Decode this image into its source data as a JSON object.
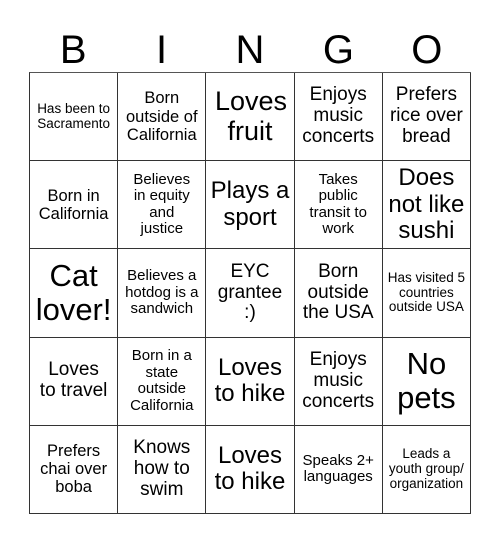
{
  "header": {
    "letters": [
      "B",
      "I",
      "N",
      "G",
      "O"
    ]
  },
  "cells": [
    [
      "Has been to Sacramento",
      "Born outside of California",
      "Loves fruit",
      "Enjoys music concerts",
      "Prefers rice over bread"
    ],
    [
      "Born in California",
      "Believes in equity and justice",
      "Plays a sport",
      "Takes public transit to work",
      "Does not like sushi"
    ],
    [
      "Cat lover!",
      "Believes a hotdog is a sandwich",
      "EYC grantee :)",
      "Born outside the USA",
      "Has visited 5 countries outside USA"
    ],
    [
      "Loves to travel",
      "Born in a state outside California",
      "Loves to hike",
      "Enjoys music concerts",
      "No pets"
    ],
    [
      "Prefers chai over boba",
      "Knows how to swim",
      "Loves to hike",
      "Speaks 2+ languages",
      "Leads a youth group/ organization"
    ]
  ]
}
